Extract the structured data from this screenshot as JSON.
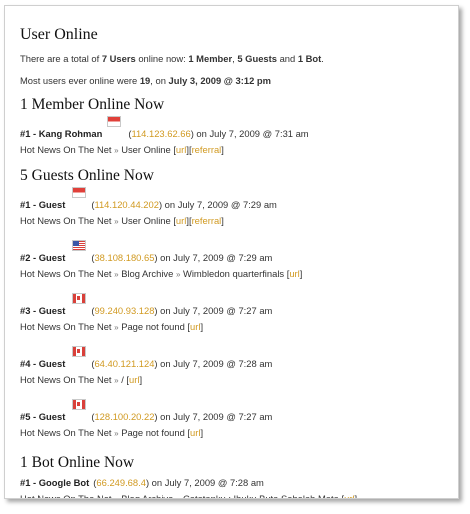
{
  "page": {
    "title": "User Online",
    "stat1": {
      "pre": "There are a total of ",
      "users": "7 Users",
      "mid": " online now: ",
      "members": "1 Member",
      "comma": ", ",
      "guests": "5 Guests",
      "and": " and ",
      "bots": "1 Bot",
      "end": "."
    },
    "stat2": {
      "pre": "Most users ever online were ",
      "count": "19",
      "mid": ", on ",
      "date": "July 3, 2009 @ 3:12 pm"
    }
  },
  "members": {
    "heading": "1 Member Online Now",
    "items": [
      {
        "num": "#1 - Kang Rohman",
        "ip": "114.123.62.66",
        "time": " on July 7, 2009 @ 7:31 am",
        "flag": "indonesia-flag-icon",
        "path": [
          "Hot News On The Net",
          "User Online"
        ],
        "links": [
          "url",
          "referral"
        ]
      }
    ]
  },
  "guests": {
    "heading": "5 Guests Online Now",
    "items": [
      {
        "num": "#1 - Guest",
        "ip": "114.120.44.202",
        "time": " on July 7, 2009 @ 7:29 am",
        "flag": "indonesia-flag-icon",
        "path": [
          "Hot News On The Net",
          "User Online"
        ],
        "links": [
          "url",
          "referral"
        ]
      },
      {
        "num": "#2 - Guest",
        "ip": "38.108.180.65",
        "time": " on July 7, 2009 @ 7:29 am",
        "flag": "usa-flag-icon",
        "path": [
          "Hot News On The Net",
          "Blog Archive",
          "Wimbledon quarterfinals"
        ],
        "links": [
          "url"
        ]
      },
      {
        "num": "#3 - Guest",
        "ip": "99.240.93.128",
        "time": " on July 7, 2009 @ 7:27 am",
        "flag": "canada-flag-icon",
        "path": [
          "Hot News On The Net",
          "Page not found"
        ],
        "links": [
          "url"
        ]
      },
      {
        "num": "#4 - Guest",
        "ip": "64.40.121.124",
        "time": " on July 7, 2009 @ 7:28 am",
        "flag": "canada-flag-icon",
        "path": [
          "Hot News On The Net",
          "/"
        ],
        "links": [
          "url"
        ]
      },
      {
        "num": "#5 - Guest",
        "ip": "128.100.20.22",
        "time": " on July 7, 2009 @ 7:27 am",
        "flag": "canada-flag-icon",
        "path": [
          "Hot News On The Net",
          "Page not found"
        ],
        "links": [
          "url"
        ]
      }
    ]
  },
  "bots": {
    "heading": "1 Bot Online Now",
    "items": [
      {
        "num": "#1 - Google Bot",
        "ip": "66.249.68.4",
        "time": " on July 7, 2009 @ 7:28 am",
        "path": [
          "Hot News On The Net",
          "Blog Archive",
          "Catatanku : Ibuku Buta Sebelah Mata"
        ],
        "links": [
          "url"
        ]
      }
    ]
  },
  "separator": "»"
}
